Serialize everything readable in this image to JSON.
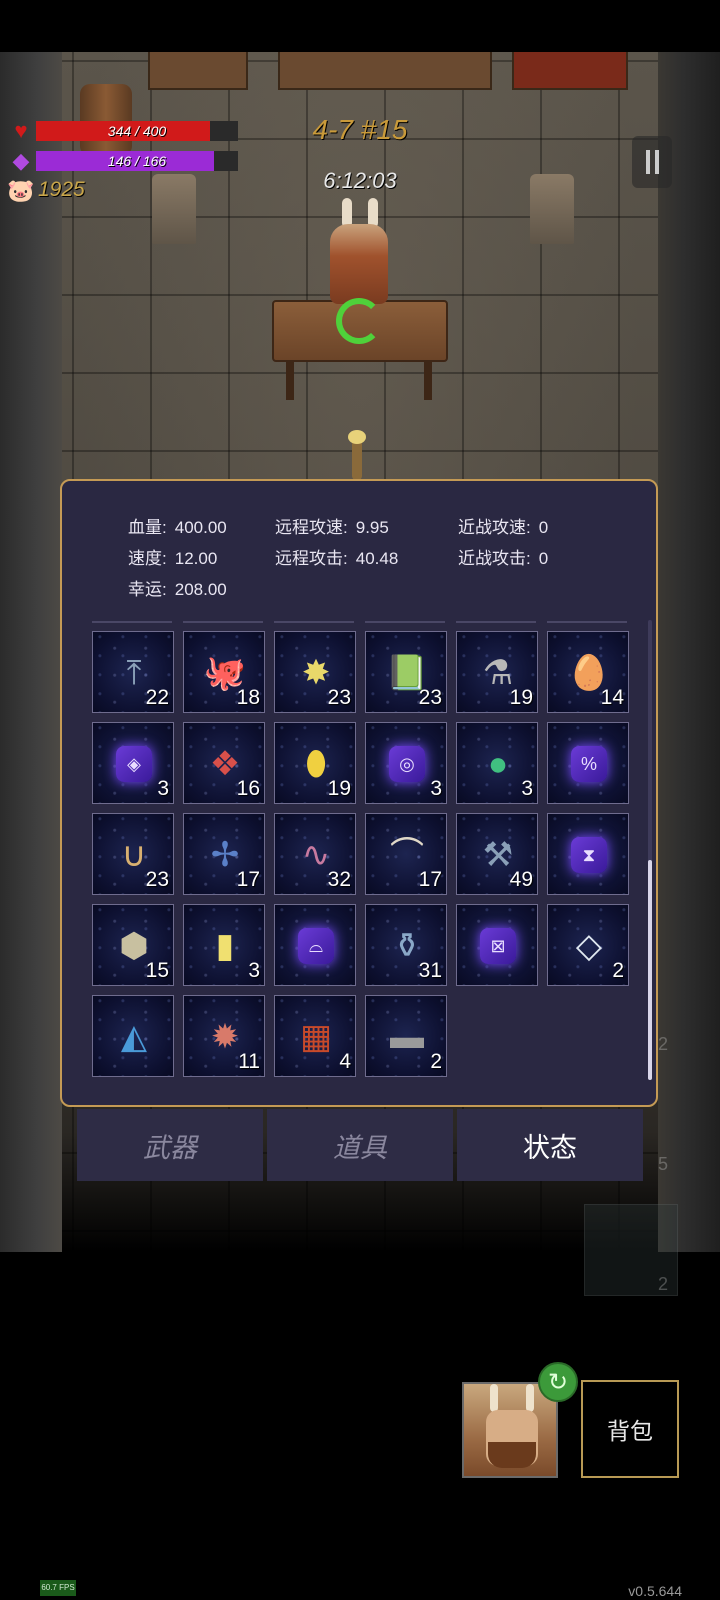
{
  "hud": {
    "hp_text": "344 / 400",
    "hp_fraction": 0.86,
    "hp_color": "#d11a1a",
    "mana_text": "146 / 166",
    "mana_fraction": 0.88,
    "mana_color": "#9b2bd6",
    "gold": "1925",
    "level": "4-7 #15",
    "timer": "6:12:03"
  },
  "stats": [
    {
      "label": "血量:",
      "value": "400.00"
    },
    {
      "label": "远程攻速:",
      "value": "9.95"
    },
    {
      "label": "近战攻速:",
      "value": "0"
    },
    {
      "label": "速度:",
      "value": "12.00"
    },
    {
      "label": "远程攻击:",
      "value": "40.48"
    },
    {
      "label": "近战攻击:",
      "value": "0"
    },
    {
      "label": "幸运:",
      "value": "208.00"
    }
  ],
  "inventory": [
    {
      "icon": "trident-icon",
      "glyph": "⤒",
      "color": "#8aa0b8",
      "count": "22"
    },
    {
      "icon": "octopus-icon",
      "glyph": "🐙",
      "color": "#8fa08a",
      "count": "18"
    },
    {
      "icon": "star-crystal-icon",
      "glyph": "✸",
      "color": "#e8d86a",
      "count": "23"
    },
    {
      "icon": "skull-book-icon",
      "glyph": "📗",
      "color": "#3a5a2a",
      "count": "23"
    },
    {
      "icon": "potion-flask-icon",
      "glyph": "⚗",
      "color": "#b8b8b8",
      "count": "19"
    },
    {
      "icon": "egg-icon",
      "glyph": "🥚",
      "color": "#b8946a",
      "count": "14"
    },
    {
      "icon": "rune-eye-icon",
      "glyph": "◈",
      "color": "#7a4aff",
      "count": "3",
      "rune": true
    },
    {
      "icon": "red-crystals-icon",
      "glyph": "❖",
      "color": "#d8504a",
      "count": "16"
    },
    {
      "icon": "yellow-gem-icon",
      "glyph": "⬮",
      "color": "#f0d040",
      "count": "19"
    },
    {
      "icon": "rune-spiral-icon",
      "glyph": "◎",
      "color": "#7a4aff",
      "count": "3",
      "rune": true
    },
    {
      "icon": "rainbow-orb-icon",
      "glyph": "●",
      "color": "#40c080",
      "count": "3"
    },
    {
      "icon": "rune-percent-icon",
      "glyph": "%",
      "color": "#7a4aff",
      "count": "",
      "rune": true
    },
    {
      "icon": "horseshoe-icon",
      "glyph": "∪",
      "color": "#d8b070",
      "count": "23"
    },
    {
      "icon": "dragonfly-icon",
      "glyph": "✢",
      "color": "#5a80c8",
      "count": "17"
    },
    {
      "icon": "worm-icon",
      "glyph": "∿",
      "color": "#c87aa0",
      "count": "32"
    },
    {
      "icon": "horn-icon",
      "glyph": "⌒",
      "color": "#e0d8c8",
      "count": "17"
    },
    {
      "icon": "hammer-icon",
      "glyph": "⚒",
      "color": "#8aa0b8",
      "count": "49"
    },
    {
      "icon": "rune-hourglass-icon",
      "glyph": "⧗",
      "color": "#7a4aff",
      "count": "",
      "rune": true
    },
    {
      "icon": "ore-rocks-icon",
      "glyph": "⬢",
      "color": "#c8c0a0",
      "count": "15"
    },
    {
      "icon": "yellow-card-icon",
      "glyph": "▮",
      "color": "#f0e070",
      "count": "3"
    },
    {
      "icon": "rune-hook-icon",
      "glyph": "⌓",
      "color": "#7a4aff",
      "count": "",
      "rune": true
    },
    {
      "icon": "bottle-icon",
      "glyph": "⚱",
      "color": "#8aa8c8",
      "count": "31"
    },
    {
      "icon": "rune-cross-icon",
      "glyph": "⊠",
      "color": "#7a4aff",
      "count": "",
      "rune": true
    },
    {
      "icon": "diamond-frame-icon",
      "glyph": "◇",
      "color": "#e0e8f0",
      "count": "2"
    },
    {
      "icon": "blue-triangle-book-icon",
      "glyph": "◭",
      "color": "#4a9ad8",
      "count": ""
    },
    {
      "icon": "spiky-creature-icon",
      "glyph": "✹",
      "color": "#d87a6a",
      "count": "11"
    },
    {
      "icon": "red-spellbook-icon",
      "glyph": "▦",
      "color": "#c84a2a",
      "count": "4"
    },
    {
      "icon": "stone-tablet-icon",
      "glyph": "▬",
      "color": "#9a9a9a",
      "count": "2"
    }
  ],
  "tabs": {
    "weapons": "武器",
    "items": "道具",
    "status": "状态"
  },
  "side_counts": {
    "a": "2",
    "b": "5",
    "c": "2"
  },
  "bottom": {
    "bag_label": "背包",
    "swap_glyph": "↻",
    "fps": "60.7 FPS",
    "version": "v0.5.644"
  }
}
